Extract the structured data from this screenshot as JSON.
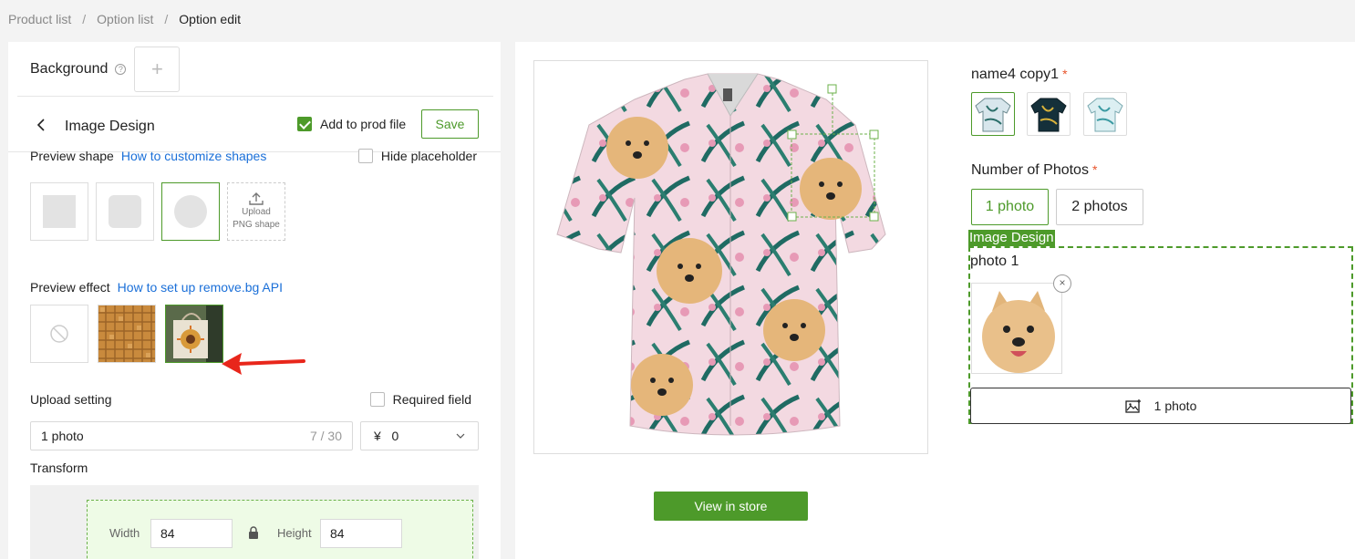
{
  "breadcrumb": {
    "items": [
      "Product list",
      "Option list",
      "Option edit"
    ],
    "separator": "/"
  },
  "left": {
    "background_label": "Background",
    "design_title": "Image Design",
    "add_to_prod_label": "Add to prod file",
    "add_to_prod_checked": true,
    "save_label": "Save",
    "preview_shape_label": "Preview shape",
    "customize_shapes_link": "How to customize shapes",
    "hide_placeholder_label": "Hide placeholder",
    "upload_png_line1": "Upload",
    "upload_png_line2": "PNG shape",
    "preview_effect_label": "Preview effect",
    "removebg_link": "How to set up remove.bg API",
    "upload_setting_label": "Upload setting",
    "required_field_label": "Required field",
    "name_value": "1 photo",
    "name_count": "7 / 30",
    "price_currency": "¥",
    "price_value": "0",
    "transform_label": "Transform",
    "width_label": "Width",
    "width_value": "84",
    "height_label": "Height",
    "height_value": "84"
  },
  "right": {
    "option_title": "name4 copy1",
    "required_star": "*",
    "number_title": "Number of Photos",
    "photo_options": [
      "1 photo",
      "2 photos"
    ],
    "selected_photo_option": "1 photo",
    "image_design_tag": "Image Design",
    "photo_label": "photo 1",
    "upload_button_label": "1 photo",
    "close_symbol": "×",
    "view_in_store": "View in store"
  },
  "colors": {
    "accent": "#4d9a2a",
    "link": "#1a6fd8",
    "required": "#e8542b"
  }
}
